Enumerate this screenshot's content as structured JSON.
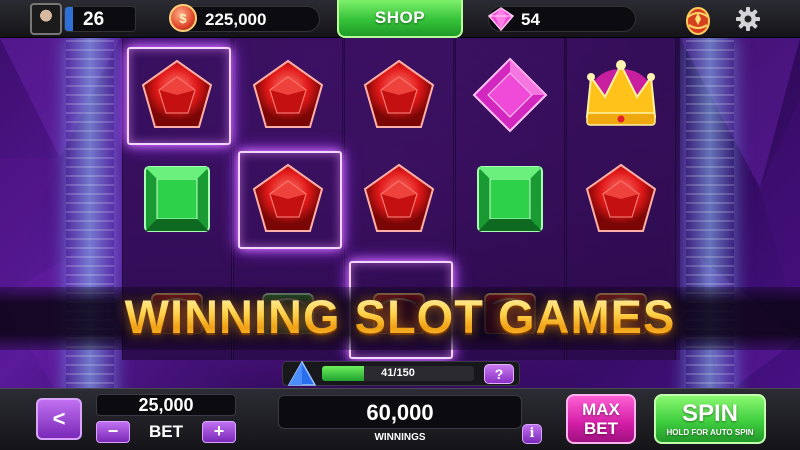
{
  "player": {
    "level": "26",
    "avatar_icon": "player-avatar"
  },
  "currency": {
    "coins": "225,000",
    "coin_icon": "coin-icon",
    "coin_symbol": "$",
    "gems": "54",
    "gem_icon": "pink-gem-icon"
  },
  "header": {
    "shop_label": "SHOP",
    "bonus_icon": "bonus-egg-icon",
    "settings_icon": "gear-icon"
  },
  "reels": {
    "columns": [
      [
        "red-gem",
        "green-gem",
        "red-card"
      ],
      [
        "red-gem",
        "red-gem",
        "green-card"
      ],
      [
        "red-gem",
        "red-gem",
        "red-card"
      ],
      [
        "pink-gem",
        "green-gem",
        "red-card"
      ],
      [
        "crown",
        "red-gem",
        "red-card"
      ]
    ],
    "winning_cells": [
      [
        0,
        0
      ],
      [
        1,
        1
      ],
      [
        2,
        2
      ]
    ]
  },
  "banner": {
    "text": "WINNING SLOT GAMES"
  },
  "progress": {
    "text": "41/150",
    "current": 41,
    "max": 150,
    "help_label": "?"
  },
  "bet": {
    "value": "25,000",
    "label": "BET",
    "minus_label": "−",
    "plus_label": "+"
  },
  "winnings": {
    "value": "60,000",
    "label": "WINNINGS",
    "info_label": "i"
  },
  "buttons": {
    "back_label": "<",
    "max_bet_line1": "MAX",
    "max_bet_line2": "BET",
    "spin_label": "SPIN",
    "spin_sub_label": "HOLD FOR AUTO SPIN"
  },
  "colors": {
    "shop_green": "#36c23a",
    "max_bet_pink": "#d21ea6",
    "spin_green": "#3fcf3f",
    "accent_purple": "#8a30c4"
  }
}
